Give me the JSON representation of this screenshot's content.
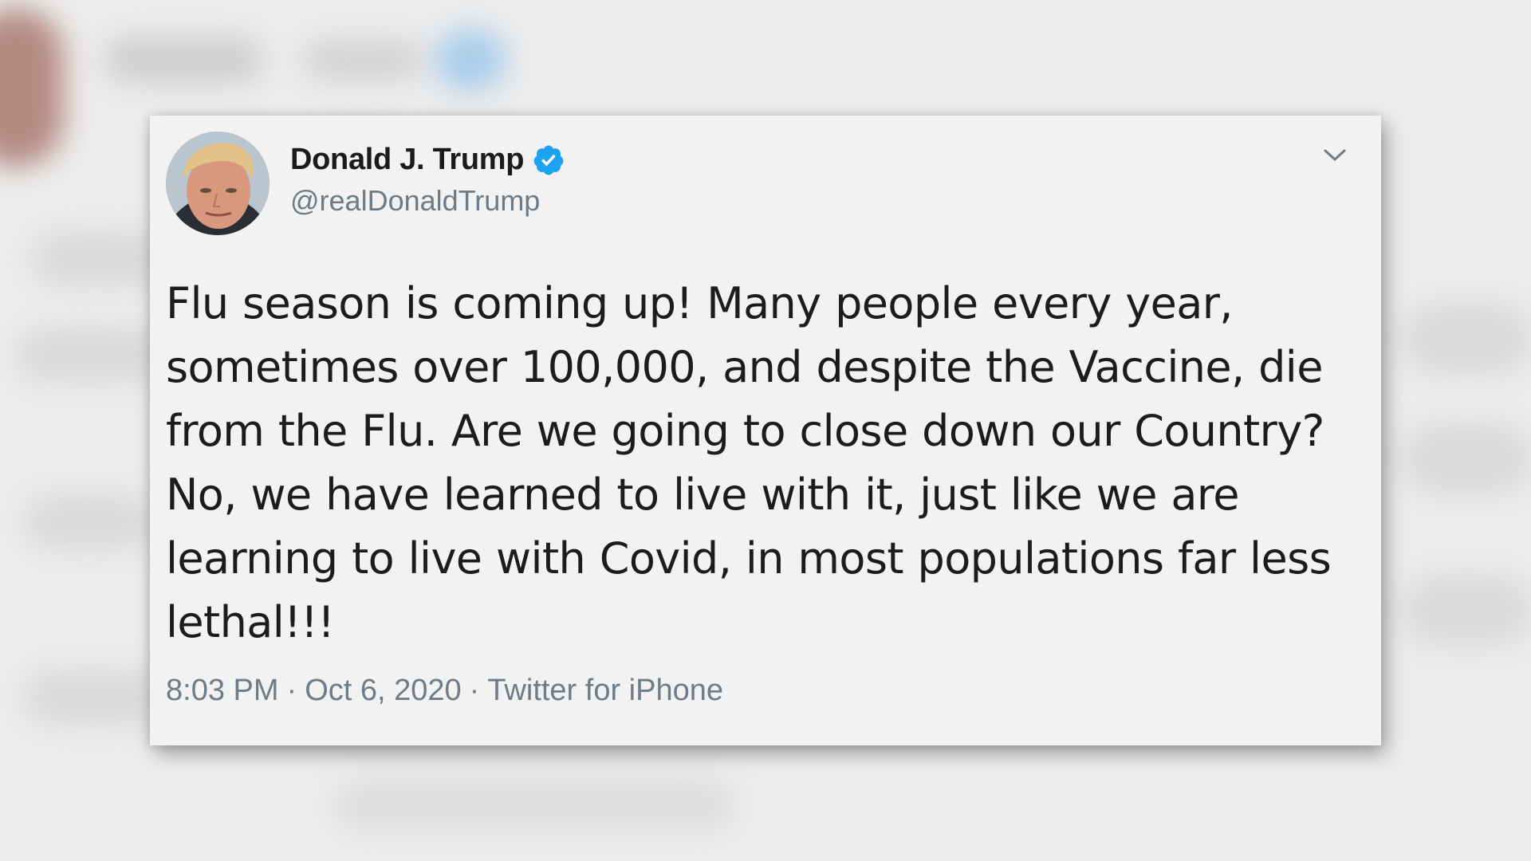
{
  "tweet": {
    "author_name": "Donald J. Trump",
    "author_handle": "@realDonaldTrump",
    "verified": true,
    "text": "Flu season is coming up! Many people every year, sometimes over 100,000, and despite the Vaccine, die from the Flu. Are we going to close down our Country? No, we have learned to live with it, just like we are learning to live with Covid, in most populations far less lethal!!!",
    "time": "8:03 PM",
    "separator": "·",
    "date": "Oct 6, 2020",
    "source": "Twitter for iPhone"
  },
  "icons": {
    "verified_badge": "verified-badge-icon",
    "more_menu": "chevron-down-icon"
  },
  "colors": {
    "verified_blue": "#1da1f2",
    "meta_gray": "#6f7b86",
    "card_bg": "#f2f2f2"
  }
}
